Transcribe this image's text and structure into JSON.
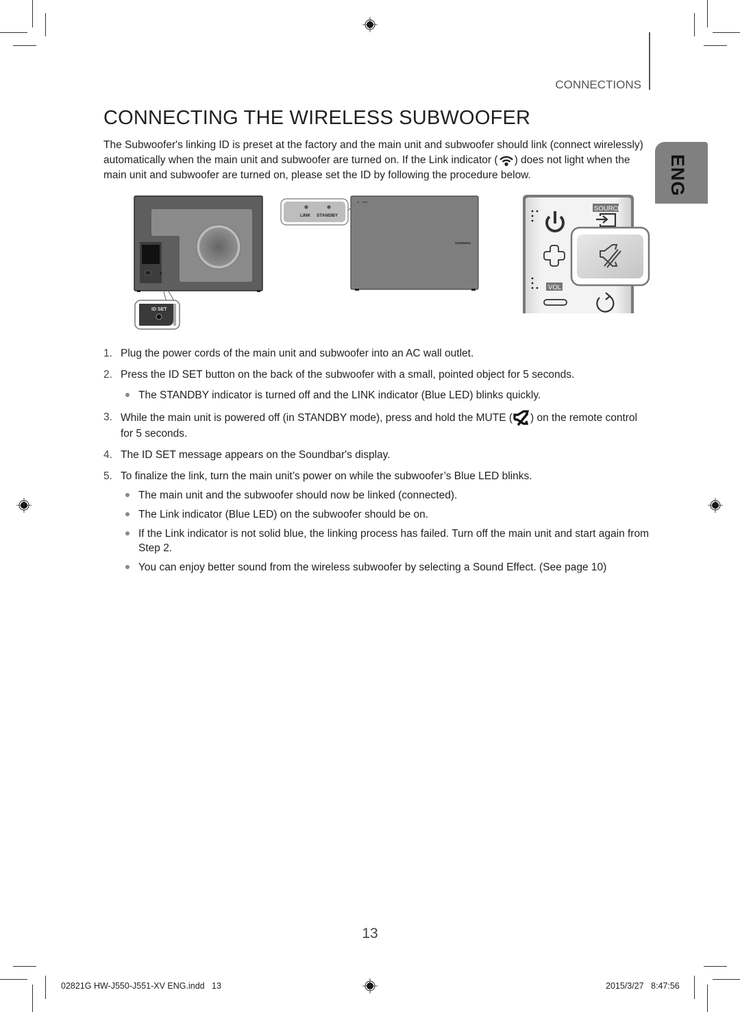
{
  "header": {
    "section_label": "CONNECTIONS",
    "language_tab": "ENG"
  },
  "title": "CONNECTING THE WIRELESS SUBWOOFER",
  "intro": {
    "part1": "The Subwoofer's linking ID is preset at the factory and the main unit and subwoofer should link (connect wirelessly) automatically when the main unit and subwoofer are turned on. If the Link indicator (",
    "icon": "link-wifi-icon",
    "part2": ") does not light when the main unit and subwoofer are turned on, please set the ID by following the procedure below."
  },
  "figures": {
    "subwoofer_back": {
      "id_set_label": "ID SET"
    },
    "subwoofer_front": {
      "indicator_labels": [
        "LINK",
        "STANDBY"
      ],
      "brand": "SAMSUNG"
    },
    "remote": {
      "source_label": "SOURCE",
      "vol_label": "VOL",
      "highlighted_button": "mute-icon"
    }
  },
  "steps": [
    {
      "num": "1.",
      "text": "Plug the power cords of the main unit and subwoofer into an AC wall outlet.",
      "bullets": []
    },
    {
      "num": "2.",
      "text": "Press the ID SET button on the back of the subwoofer with a small, pointed object for 5 seconds.",
      "bullets": [
        "The STANDBY indicator is turned off and the LINK indicator (Blue LED) blinks quickly."
      ]
    },
    {
      "num": "3.",
      "text_before_icon": "While the main unit is powered off (in STANDBY mode), press and hold the MUTE (",
      "icon": "mute-icon",
      "text_after_icon": ") on the remote control for 5 seconds.",
      "bullets": []
    },
    {
      "num": "4.",
      "text": "The ID SET message appears on the Soundbar's display.",
      "bullets": []
    },
    {
      "num": "5.",
      "text": "To finalize the link, turn the main unit’s power on while the subwoofer’s Blue LED blinks.",
      "bullets": [
        "The main unit and the subwoofer should now be linked (connected).",
        "The Link indicator (Blue LED) on the subwoofer should be on.",
        "If the Link indicator is not solid blue, the linking process has failed. Turn off the main unit and start again from Step 2.",
        "You can enjoy better sound from the wireless subwoofer by selecting a Sound Effect. (See page 10)"
      ]
    }
  ],
  "page_number": "13",
  "footer": {
    "file": "02821G HW-J550-J551-XV ENG.indd   13",
    "timestamp": "2015/3/27   8:47:56"
  }
}
